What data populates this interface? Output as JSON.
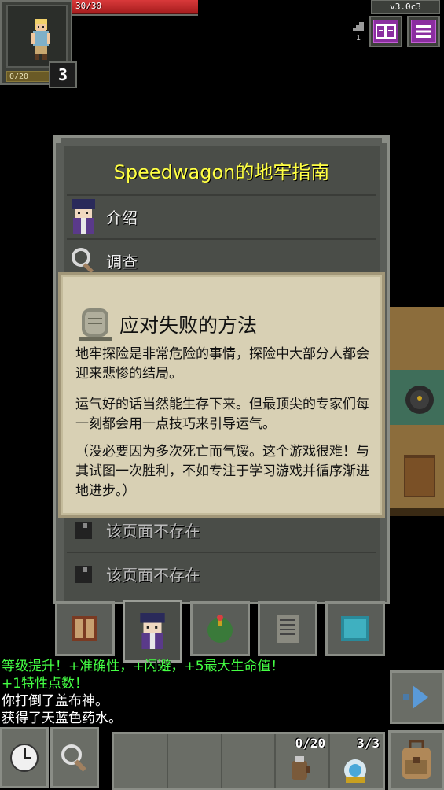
{
  "hud": {
    "hp_text": "30/30",
    "hp_fraction": 1.0,
    "xp_text": "0/20",
    "xp_fraction": 0.0,
    "level": "3",
    "version": "v3.0c3",
    "depth": "1",
    "journal_icon": "journal-book-icon",
    "menu_icon": "hamburger-menu-icon",
    "accent_color": "#8b2ea0"
  },
  "journal": {
    "title": "Speedwagon的地牢指南",
    "entries": [
      {
        "label": "介绍",
        "icon": "guide-character-icon"
      },
      {
        "label": "调查",
        "icon": "magnifier-icon"
      },
      {
        "label": "该页面不存在",
        "icon": "missing-page-icon"
      },
      {
        "label": "该页面不存在",
        "icon": "missing-page-icon"
      }
    ],
    "tabs": [
      "catalog-tab",
      "guide-tab",
      "alchemy-tab",
      "notes-tab",
      "map-tab"
    ],
    "title_color": "#ffff44"
  },
  "dialog": {
    "title": "应对失败的方法",
    "paragraphs": [
      "地牢探险是非常危险的事情，探险中大部分人都会迎来悲惨的结局。",
      "运气好的话当然能生存下来。但最顶尖的专家们每一刻都会用一点技巧来引导运气。",
      "（没必要因为多次死亡而气馁。这个游戏很难！与其试图一次胜利，不如专注于学习游戏并循序渐进地进步。）"
    ]
  },
  "log": [
    {
      "text": "等级提升！+准确性，+闪避，+5最大生命值！",
      "color": "green"
    },
    {
      "text": "+1特性点数！",
      "color": "green"
    },
    {
      "text": "你打倒了盖布神。",
      "color": "white"
    },
    {
      "text": "获得了天蓝色药水。",
      "color": "white"
    }
  ],
  "toolbar": {
    "wait_icon": "clock-icon",
    "search_icon": "search-icon",
    "slot1_count": "0/20",
    "slot2_count": "3/3",
    "resume_icon": "resume-arrow-icon",
    "backpack_icon": "backpack-icon"
  }
}
